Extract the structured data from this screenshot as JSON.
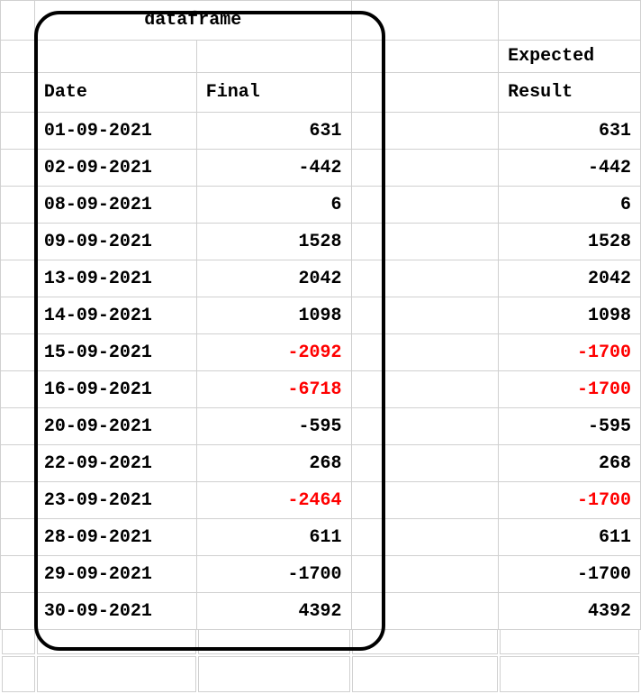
{
  "title": "dataframe",
  "headers": {
    "date": "Date",
    "final": "Final",
    "expected": "Expected",
    "result": "Result"
  },
  "rows": [
    {
      "date": "01-09-2021",
      "final": "631",
      "final_red": false,
      "result": "631",
      "result_red": false
    },
    {
      "date": "02-09-2021",
      "final": "-442",
      "final_red": false,
      "result": "-442",
      "result_red": false
    },
    {
      "date": "08-09-2021",
      "final": "6",
      "final_red": false,
      "result": "6",
      "result_red": false
    },
    {
      "date": "09-09-2021",
      "final": "1528",
      "final_red": false,
      "result": "1528",
      "result_red": false
    },
    {
      "date": "13-09-2021",
      "final": "2042",
      "final_red": false,
      "result": "2042",
      "result_red": false
    },
    {
      "date": "14-09-2021",
      "final": "1098",
      "final_red": false,
      "result": "1098",
      "result_red": false
    },
    {
      "date": "15-09-2021",
      "final": "-2092",
      "final_red": true,
      "result": "-1700",
      "result_red": true
    },
    {
      "date": "16-09-2021",
      "final": "-6718",
      "final_red": true,
      "result": "-1700",
      "result_red": true
    },
    {
      "date": "20-09-2021",
      "final": "-595",
      "final_red": false,
      "result": "-595",
      "result_red": false
    },
    {
      "date": "22-09-2021",
      "final": "268",
      "final_red": false,
      "result": "268",
      "result_red": false
    },
    {
      "date": "23-09-2021",
      "final": "-2464",
      "final_red": true,
      "result": "-1700",
      "result_red": true
    },
    {
      "date": "28-09-2021",
      "final": "611",
      "final_red": false,
      "result": "611",
      "result_red": false
    },
    {
      "date": "29-09-2021",
      "final": "-1700",
      "final_red": false,
      "result": "-1700",
      "result_red": false
    },
    {
      "date": "30-09-2021",
      "final": "4392",
      "final_red": false,
      "result": "4392",
      "result_red": false
    }
  ]
}
